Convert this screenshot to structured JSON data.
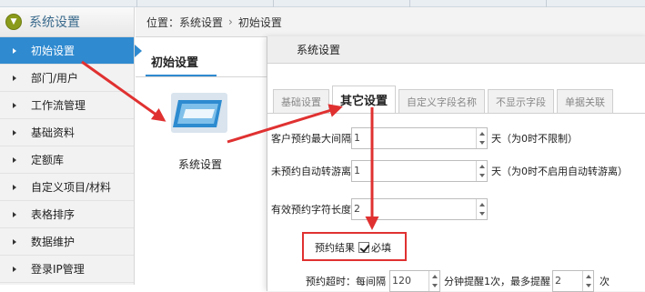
{
  "sidebar": {
    "title": "系统设置",
    "items": [
      {
        "label": "初始设置",
        "active": true
      },
      {
        "label": "部门/用户"
      },
      {
        "label": "工作流管理"
      },
      {
        "label": "基础资料"
      },
      {
        "label": "定额库"
      },
      {
        "label": "自定义项目/材料"
      },
      {
        "label": "表格排序"
      },
      {
        "label": "数据维护"
      },
      {
        "label": "登录IP管理"
      }
    ]
  },
  "breadcrumb": {
    "prefix": "位置：",
    "parts": [
      "系统设置",
      "初始设置"
    ],
    "separator": "›"
  },
  "panel": {
    "title": "初始设置",
    "tile_label": "系统设置"
  },
  "dialog": {
    "title": "系统设置",
    "tabs": [
      "基础设置",
      "其它设置",
      "自定义字段名称",
      "不显示字段",
      "单据关联"
    ],
    "active_tab": "其它设置",
    "fields": {
      "max_interval": {
        "label": "客户预约最大间隔",
        "value": "1",
        "unit": "天（为0时不限制）"
      },
      "auto_transfer": {
        "label": "未预约自动转游离",
        "value": "1",
        "unit": "天（为0时不启用自动转游离）"
      },
      "char_length": {
        "label": "有效预约字符长度",
        "value": "2"
      },
      "result_required": {
        "label": "预约结果",
        "checkbox_label": "必填",
        "checked": true
      },
      "timeout": {
        "label": "预约超时：每间隔",
        "value": "120",
        "mid": "分钟提醒1次，最多提醒",
        "count": "2",
        "suffix": "次"
      }
    }
  },
  "colors": {
    "accent": "#2f8ad0",
    "arrow": "#e03131",
    "sidebar_icon": "#8a9a1a"
  }
}
